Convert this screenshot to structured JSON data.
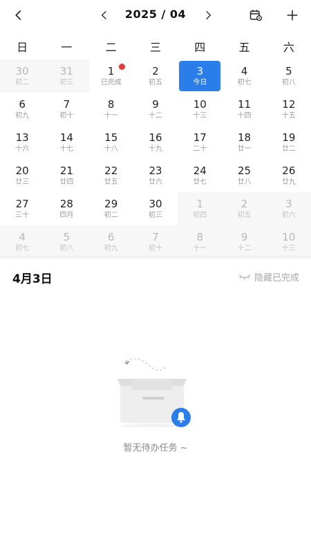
{
  "header": {
    "month_title": "2025 / 04",
    "back_icon": "chevron-left-icon",
    "prev_icon": "chevron-left-icon",
    "next_icon": "chevron-right-icon",
    "calendar_settings_icon": "calendar-gear-icon",
    "add_icon": "plus-icon"
  },
  "weekdays": [
    "日",
    "一",
    "二",
    "三",
    "四",
    "五",
    "六"
  ],
  "days": [
    {
      "d": "30",
      "l": "初二",
      "other": true
    },
    {
      "d": "31",
      "l": "初三",
      "other": true
    },
    {
      "d": "1",
      "l": "已完成",
      "dot": true
    },
    {
      "d": "2",
      "l": "初五"
    },
    {
      "d": "3",
      "l": "今日",
      "today": true
    },
    {
      "d": "4",
      "l": "初七"
    },
    {
      "d": "5",
      "l": "初八"
    },
    {
      "d": "6",
      "l": "初九"
    },
    {
      "d": "7",
      "l": "初十"
    },
    {
      "d": "8",
      "l": "十一"
    },
    {
      "d": "9",
      "l": "十二"
    },
    {
      "d": "10",
      "l": "十三"
    },
    {
      "d": "11",
      "l": "十四"
    },
    {
      "d": "12",
      "l": "十五"
    },
    {
      "d": "13",
      "l": "十六"
    },
    {
      "d": "14",
      "l": "十七"
    },
    {
      "d": "15",
      "l": "十八"
    },
    {
      "d": "16",
      "l": "十九"
    },
    {
      "d": "17",
      "l": "二十"
    },
    {
      "d": "18",
      "l": "廿一"
    },
    {
      "d": "19",
      "l": "廿二"
    },
    {
      "d": "20",
      "l": "廿三"
    },
    {
      "d": "21",
      "l": "廿四"
    },
    {
      "d": "22",
      "l": "廿五"
    },
    {
      "d": "23",
      "l": "廿六"
    },
    {
      "d": "24",
      "l": "廿七"
    },
    {
      "d": "25",
      "l": "廿八"
    },
    {
      "d": "26",
      "l": "廿九"
    },
    {
      "d": "27",
      "l": "三十"
    },
    {
      "d": "28",
      "l": "四月"
    },
    {
      "d": "29",
      "l": "初二"
    },
    {
      "d": "30",
      "l": "初三"
    },
    {
      "d": "1",
      "l": "初四",
      "other": true
    },
    {
      "d": "2",
      "l": "初五",
      "other": true
    },
    {
      "d": "3",
      "l": "初六",
      "other": true
    },
    {
      "d": "4",
      "l": "初七",
      "other": true
    },
    {
      "d": "5",
      "l": "初八",
      "other": true
    },
    {
      "d": "6",
      "l": "初九",
      "other": true
    },
    {
      "d": "7",
      "l": "初十",
      "other": true
    },
    {
      "d": "8",
      "l": "十一",
      "other": true
    },
    {
      "d": "9",
      "l": "十二",
      "other": true
    },
    {
      "d": "10",
      "l": "十三",
      "other": true
    }
  ],
  "selected": {
    "date_title": "4月3日",
    "hide_completed_label": "隐藏已完成",
    "hide_completed_icon": "eye-closed-icon"
  },
  "empty": {
    "text": "暂无待办任务 ~",
    "illustration_icon": "empty-inbox-icon",
    "bell_icon": "bell-icon"
  },
  "colors": {
    "accent": "#2b7de9",
    "dot": "#e23b3b"
  }
}
